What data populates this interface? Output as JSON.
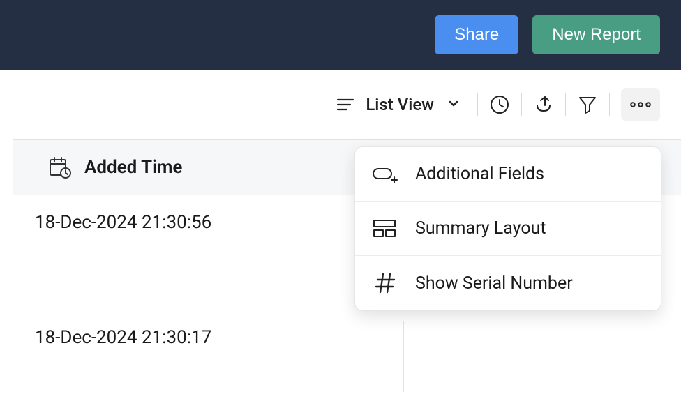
{
  "header": {
    "share_label": "Share",
    "new_report_label": "New Report"
  },
  "toolbar": {
    "view_label": "List View"
  },
  "table": {
    "column_header": "Added Time",
    "rows": [
      {
        "added_time": "18-Dec-2024 21:30:56"
      },
      {
        "added_time": "18-Dec-2024 21:30:17"
      }
    ]
  },
  "more_menu": {
    "items": [
      {
        "label": "Additional Fields"
      },
      {
        "label": "Summary Layout"
      },
      {
        "label": "Show Serial Number"
      }
    ]
  }
}
